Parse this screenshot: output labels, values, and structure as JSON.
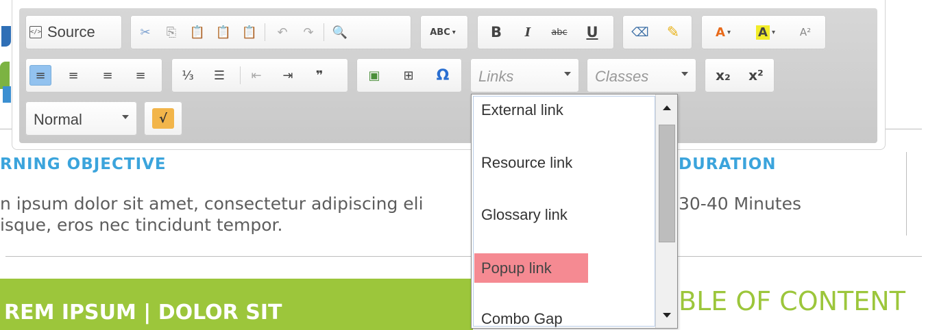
{
  "page": {
    "learning_objective_heading": "RNING OBJECTIVE",
    "learning_objective_text_1": "n ipsum dolor sit amet, consectetur adipiscing eli",
    "learning_objective_text_2": "isque, eros nec tincidunt tempor.",
    "duration_heading": "DURATION",
    "duration_value": "30-40 Minutes",
    "green_banner_text": "REM IPSUM | DOLOR SIT",
    "toc_heading": "BLE OF CONTENT"
  },
  "toolbar": {
    "source_label": "Source",
    "links_placeholder": "Links",
    "classes_placeholder": "Classes",
    "format_value": "Normal",
    "icons": {
      "cut": "✂",
      "copy": "⎘",
      "paste": "📋",
      "paste_text": "📋",
      "paste_word": "📋",
      "undo": "↶",
      "redo": "↷",
      "find": "🔍",
      "spellcheck": "ABC",
      "bold": "B",
      "italic": "I",
      "strike": "abc",
      "underline": "U",
      "eraser": "⌫",
      "highlight": "✎",
      "text_color": "A",
      "bg_color": "A",
      "font_size": "A²",
      "align_left": "≡",
      "align_center": "≡",
      "align_right": "≡",
      "justify": "≡",
      "numbered_list": "⅓",
      "bullet_list": "☰",
      "outdent": "⇤",
      "indent": "⇥",
      "blockquote": "❞",
      "image": "▣",
      "table": "⊞",
      "special_char": "Ω",
      "subscript": "x₂",
      "superscript": "x²",
      "math": "√"
    }
  },
  "links_dropdown": {
    "items": [
      "External link",
      "Resource link",
      "Glossary link",
      "Popup link",
      "Combo Gap"
    ],
    "highlighted": "Popup link"
  },
  "colors": {
    "heading_blue": "#3ba4dc",
    "accent_green": "#9cc63b",
    "highlight_red": "#f58a92",
    "active_button": "#92c2ef"
  }
}
